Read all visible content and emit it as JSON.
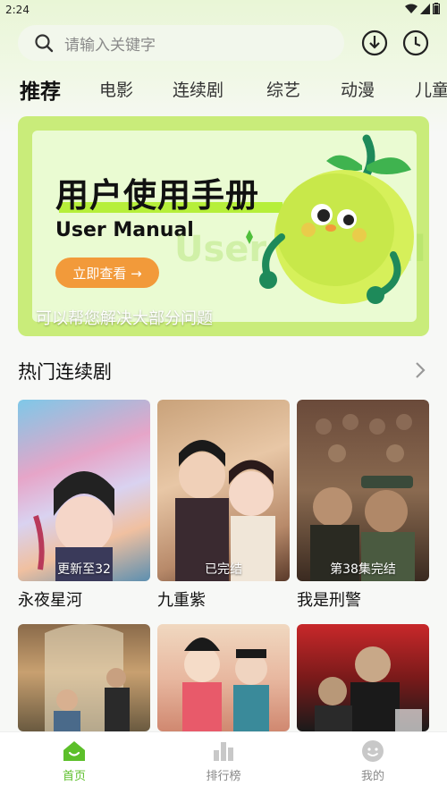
{
  "status": {
    "time": "2:24"
  },
  "search": {
    "placeholder": "请输入关键字"
  },
  "tabs": [
    {
      "label": "推荐",
      "active": true
    },
    {
      "label": "电影"
    },
    {
      "label": "连续剧"
    },
    {
      "label": "综艺"
    },
    {
      "label": "动漫"
    },
    {
      "label": "儿童"
    }
  ],
  "banner": {
    "title": "用户使用手册",
    "subtitle": "User Manual",
    "button": "立即查看 →",
    "caption": "可以帮您解决大部分问题",
    "ghost_text": "User Manual"
  },
  "section": {
    "title": "热门连续剧"
  },
  "cards": [
    {
      "title": "永夜星河",
      "badge": "更新至32"
    },
    {
      "title": "九重紫",
      "badge": "已完结"
    },
    {
      "title": "我是刑警",
      "badge": "第38集完结"
    }
  ],
  "nav": [
    {
      "label": "首页",
      "icon": "home-icon",
      "active": true
    },
    {
      "label": "排行榜",
      "icon": "bar-chart-icon"
    },
    {
      "label": "我的",
      "icon": "face-icon"
    }
  ],
  "colors": {
    "accent": "#5cbf2a",
    "banner": "#c9ec7a",
    "button": "#f29a3a"
  }
}
